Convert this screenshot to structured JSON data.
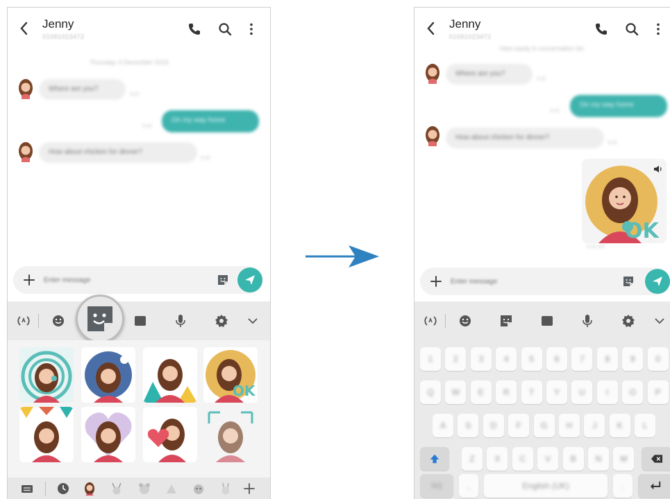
{
  "conversation": {
    "contact_name": "Jenny",
    "contact_number": "01091023472",
    "date_line": "Thursday, 6 December 2018",
    "date_line_right": "View easily in conversation list",
    "messages": [
      {
        "direction": "in",
        "text": "Where are you?",
        "time": "9:42"
      },
      {
        "direction": "out",
        "text": "On my way home",
        "time": "9:43"
      },
      {
        "direction": "in",
        "text": "How about chicken for dinner?",
        "time": "9:45"
      }
    ],
    "sticker_time": "9:46 AM"
  },
  "composer": {
    "placeholder": "Enter message"
  },
  "toolbar": {
    "icons": [
      "emoji-sync-icon",
      "smiley-icon",
      "sticker-icon",
      "gif-icon",
      "microphone-icon",
      "settings-icon",
      "chevron-down-icon"
    ]
  },
  "sticker_tabs": {
    "icons": [
      "keyboard-icon",
      "recent-icon",
      "ar-emoji-icon",
      "animal-icon",
      "animal-icon",
      "animal-icon",
      "animal-icon",
      "animal-icon",
      "add-icon"
    ]
  },
  "keyboard": {
    "row1": [
      "1",
      "2",
      "3",
      "4",
      "5",
      "6",
      "7",
      "8",
      "9",
      "0"
    ],
    "row2": [
      "Q",
      "W",
      "E",
      "R",
      "T",
      "Y",
      "U",
      "I",
      "O",
      "P"
    ],
    "row3": [
      "A",
      "S",
      "D",
      "F",
      "G",
      "H",
      "J",
      "K",
      "L"
    ],
    "row4": [
      "Z",
      "X",
      "C",
      "V",
      "B",
      "N",
      "M"
    ],
    "sym_label": "!#1",
    "comma_label": ",",
    "space_label": "English (UK)",
    "period_label": "."
  },
  "colors": {
    "accent": "#39b6ae",
    "outgoing_bubble": "#3fb3ae",
    "arrow": "#2f82c0",
    "shift": "#2a7bd4"
  }
}
